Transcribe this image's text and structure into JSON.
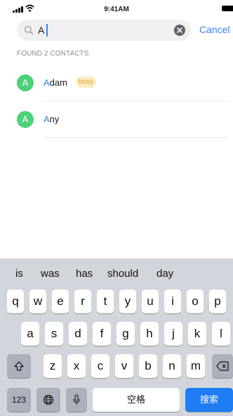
{
  "status_bar": {
    "time": "9:41AM"
  },
  "search": {
    "query": "A",
    "cancel_label": "Cancel"
  },
  "results": {
    "header": "FOUND 2 CONTACTS",
    "contacts": [
      {
        "initial": "A",
        "name_match": "A",
        "name_rest": "dam",
        "badge": "busy"
      },
      {
        "initial": "A",
        "name_match": "A",
        "name_rest": "ny"
      }
    ]
  },
  "keyboard": {
    "suggestions": [
      "is",
      "was",
      "has",
      "should",
      "day"
    ],
    "row1": [
      "q",
      "w",
      "e",
      "r",
      "t",
      "y",
      "u",
      "i",
      "o",
      "p"
    ],
    "row2": [
      "a",
      "s",
      "d",
      "f",
      "g",
      "h",
      "j",
      "k",
      "l"
    ],
    "row3": [
      "z",
      "x",
      "c",
      "v",
      "b",
      "n",
      "m"
    ],
    "numbers_label": "123",
    "space_label": "空格",
    "search_label": "搜索"
  },
  "colors": {
    "accent": "#3a82f7",
    "avatar": "#4cd07a",
    "badge_bg": "#fdedc4",
    "badge_text": "#f0a020",
    "keyboard_bg": "#d2d5db",
    "search_key": "#1f7cf5"
  },
  "icons": [
    "signal-icon",
    "wifi-icon",
    "battery-icon",
    "search-icon",
    "clear-icon",
    "shift-icon",
    "globe-icon",
    "microphone-icon",
    "backspace-icon"
  ]
}
